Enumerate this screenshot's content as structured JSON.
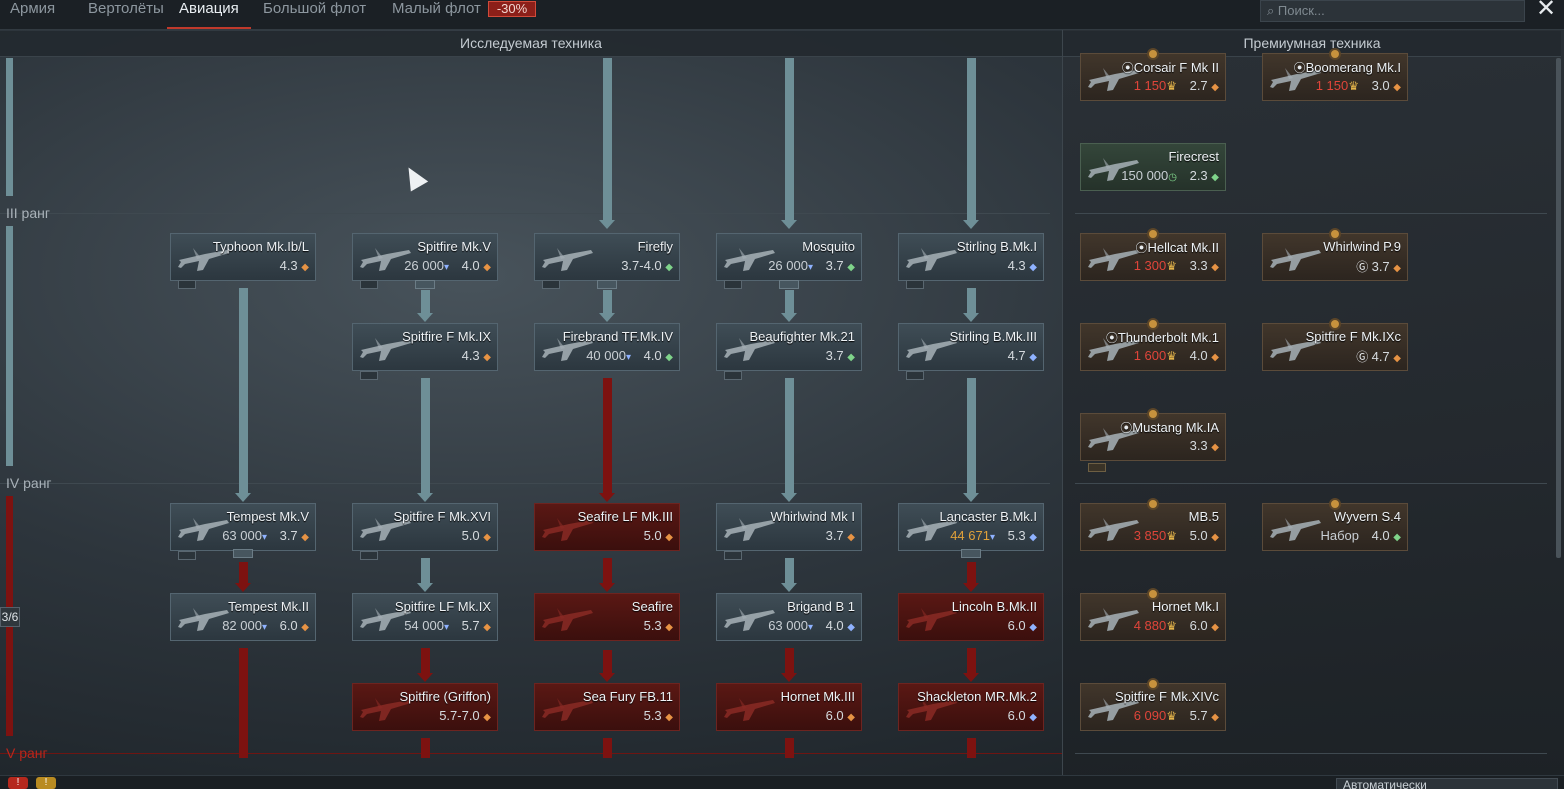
{
  "tabs": [
    {
      "label": "Армия"
    },
    {
      "label": "Вертолёты"
    },
    {
      "label": "Авиация"
    },
    {
      "label": "Большой флот"
    },
    {
      "label": "Малый флот"
    }
  ],
  "discount": "-30%",
  "search": {
    "placeholder": "Поиск...",
    "icon": "search-icon"
  },
  "close_icon": "close-icon",
  "sections": {
    "researched": "Исследуемая техника",
    "premium": "Премиумная техника"
  },
  "ranks": [
    "III ранг",
    "IV ранг",
    "V ранг"
  ],
  "progress": "3/6",
  "colors": {
    "research": "#6e8f97",
    "locked": "#7d1210",
    "premium_bg": "#41362b",
    "cost_red": "#e0453a",
    "discount_bg": "#8c1f19"
  },
  "research_tree": [
    {
      "name": "Typhoon Mk.Ib/L",
      "cost": "",
      "br": "4.3",
      "br_icon": "o",
      "state": "normal"
    },
    {
      "name": "Spitfire Mk.V",
      "cost": "26 000",
      "br": "4.0",
      "br_icon": "o",
      "state": "normal"
    },
    {
      "name": "Firefly",
      "cost": "",
      "br": "3.7-4.0",
      "br_icon": "g",
      "state": "normal"
    },
    {
      "name": "Mosquito",
      "cost": "26 000",
      "br": "3.7",
      "br_icon": "g",
      "state": "normal"
    },
    {
      "name": "Stirling B.Mk.I",
      "cost": "",
      "br": "4.3",
      "br_icon": "b",
      "state": "normal"
    },
    {
      "name": "Spitfire F Mk.IX",
      "cost": "",
      "br": "4.3",
      "br_icon": "o",
      "state": "normal"
    },
    {
      "name": "Firebrand TF.Mk.IV",
      "cost": "40 000",
      "br": "4.0",
      "br_icon": "g",
      "state": "normal"
    },
    {
      "name": "Beaufighter Mk.21",
      "cost": "",
      "br": "3.7",
      "br_icon": "g",
      "state": "normal"
    },
    {
      "name": "Stirling B.Mk.III",
      "cost": "",
      "br": "4.7",
      "br_icon": "b",
      "state": "normal"
    },
    {
      "name": "Tempest Mk.V",
      "cost": "63 000",
      "br": "3.7",
      "br_icon": "o",
      "state": "normal"
    },
    {
      "name": "Spitfire F Mk.XVI",
      "cost": "",
      "br": "5.0",
      "br_icon": "o",
      "state": "normal"
    },
    {
      "name": "Seafire LF Mk.III",
      "cost": "",
      "br": "5.0",
      "br_icon": "o",
      "state": "red"
    },
    {
      "name": "Whirlwind Mk I",
      "cost": "",
      "br": "3.7",
      "br_icon": "o",
      "state": "normal"
    },
    {
      "name": "Lancaster B.Mk.I",
      "cost": "44 671",
      "br": "5.3",
      "br_icon": "b",
      "state": "normal"
    },
    {
      "name": "Tempest Mk.II",
      "cost": "82 000",
      "br": "6.0",
      "br_icon": "o",
      "state": "normal"
    },
    {
      "name": "Spitfire LF Mk.IX",
      "cost": "54 000",
      "br": "5.7",
      "br_icon": "o",
      "state": "normal"
    },
    {
      "name": "Seafire",
      "cost": "",
      "br": "5.3",
      "br_icon": "o",
      "state": "red"
    },
    {
      "name": "Brigand B 1",
      "cost": "63 000",
      "br": "4.0",
      "br_icon": "b",
      "state": "normal"
    },
    {
      "name": "Lincoln B.Mk.II",
      "cost": "",
      "br": "6.0",
      "br_icon": "b",
      "state": "red"
    },
    {
      "name": "Spitfire (Griffon)",
      "cost": "",
      "br": "5.7-7.0",
      "br_icon": "o",
      "state": "red"
    },
    {
      "name": "Sea Fury FB.11",
      "cost": "",
      "br": "5.3",
      "br_icon": "o",
      "state": "red"
    },
    {
      "name": "Hornet Mk.III",
      "cost": "",
      "br": "6.0",
      "br_icon": "o",
      "state": "red"
    },
    {
      "name": "Shackleton MR.Mk.2",
      "cost": "",
      "br": "6.0",
      "br_icon": "b",
      "state": "red"
    }
  ],
  "premium_tree": [
    {
      "name": "Corsair F Mk II",
      "cost": "1 150",
      "br": "2.7",
      "br_icon": "o",
      "marker": "ring"
    },
    {
      "name": "Boomerang Mk.I",
      "cost": "1 150",
      "br": "3.0",
      "br_icon": "o",
      "marker": "ring"
    },
    {
      "name": "Firecrest",
      "cost": "150 000",
      "br": "2.3",
      "br_icon": "g",
      "marker": ""
    },
    {
      "name": "Hellcat Mk.II",
      "cost": "1 300",
      "br": "3.3",
      "br_icon": "o",
      "marker": "ring"
    },
    {
      "name": "Whirlwind P.9",
      "cost": "",
      "br": "3.7",
      "br_icon": "o",
      "marker": "gift"
    },
    {
      "name": "Thunderbolt Mk.1",
      "cost": "1 600",
      "br": "4.0",
      "br_icon": "o",
      "marker": "ring"
    },
    {
      "name": "Spitfire F Mk.IXc",
      "cost": "",
      "br": "4.7",
      "br_icon": "o",
      "marker": "gift"
    },
    {
      "name": "Mustang Mk.IA",
      "cost": "",
      "br": "3.3",
      "br_icon": "o",
      "marker": "ring"
    },
    {
      "name": "MB.5",
      "cost": "3 850",
      "br": "5.0",
      "br_icon": "o",
      "marker": ""
    },
    {
      "name": "Wyvern S.4",
      "cost": "Набор",
      "br": "4.0",
      "br_icon": "g",
      "marker": ""
    },
    {
      "name": "Hornet Mk.I",
      "cost": "4 880",
      "br": "6.0",
      "br_icon": "o",
      "marker": ""
    },
    {
      "name": "Spitfire F Mk.XIVc",
      "cost": "6 090",
      "br": "5.7",
      "br_icon": "o",
      "marker": ""
    }
  ],
  "bottom": {
    "dropdown": "Автоматически"
  }
}
